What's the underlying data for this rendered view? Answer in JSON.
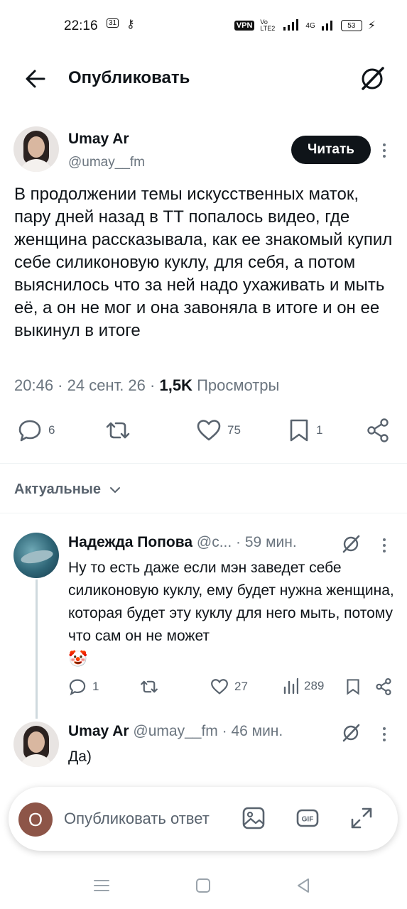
{
  "status_bar": {
    "time": "22:16",
    "calendar_badge": "31",
    "vpn": "VPN",
    "volte": "Vo LTE2",
    "network": "4G",
    "battery": "53"
  },
  "header": {
    "title": "Опубликовать"
  },
  "post": {
    "author_name": "Umay Ar",
    "author_handle": "@umay__fm",
    "follow_label": "Читать",
    "text": "В продолжении темы искусственных маток, пару дней назад в ТТ попалось видео, где женщина рассказывала, как ее знакомый купил себе силиконовую куклу, для себя, а потом выяснилось что за ней надо ухаживать и мыть её, а он не мог и она завоняла в итоге и он ее выкинул в итоге",
    "time": "20:46 · 24 сент. 26 · ",
    "views_count": "1,5K",
    "views_label": " Просмотры",
    "replies": "6",
    "reposts": "",
    "likes": "75",
    "bookmarks": "1"
  },
  "sort": {
    "label": "Актуальные"
  },
  "replies": [
    {
      "name": "Надежда Попова",
      "handle_time": " @с... · 59 мин.",
      "text": "Ну то есть даже если мэн заведет себе силиконовую куклу, ему будет нужна женщина, которая будет эту куклу для него мыть, потому что сам он не может",
      "emoji": "🤡",
      "replies": "1",
      "reposts": "",
      "likes": "27",
      "views": "289"
    },
    {
      "name": "Umay Ar",
      "handle_time": " @umay__fm · 46 мин.",
      "text": "Да)"
    }
  ],
  "composer": {
    "user_initial": "O",
    "placeholder": "Опубликовать ответ"
  },
  "colors": {
    "text": "#0f1419",
    "secondary": "#6b757f",
    "divider": "#eff3f4",
    "avatar_initial_bg": "#8d5548"
  }
}
